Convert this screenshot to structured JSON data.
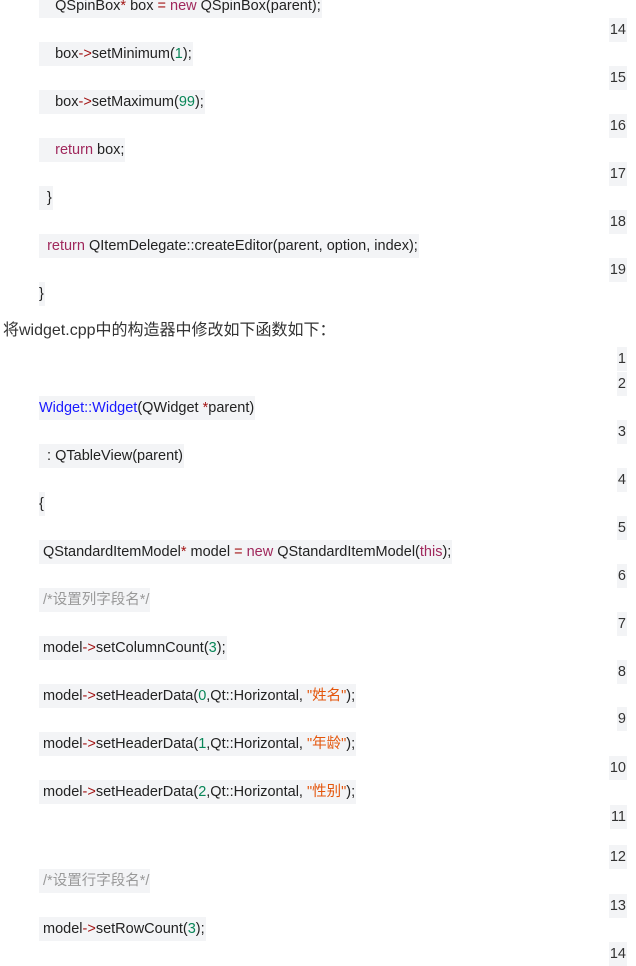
{
  "block1": {
    "lines": [
      [
        [
          "    QSpinBox",
          ""
        ],
        [
          "*",
          "op"
        ],
        [
          " box ",
          ""
        ],
        [
          "=",
          "op"
        ],
        [
          " ",
          ""
        ],
        [
          "new",
          "kw"
        ],
        [
          " QSpinBox(parent);",
          ""
        ]
      ],
      [
        [
          "    box",
          ""
        ],
        [
          "->",
          "op"
        ],
        [
          "setMinimum(",
          ""
        ],
        [
          "1",
          "num"
        ],
        [
          ");",
          ""
        ]
      ],
      [
        [
          "    box",
          ""
        ],
        [
          "->",
          "op"
        ],
        [
          "setMaximum(",
          ""
        ],
        [
          "99",
          "num"
        ],
        [
          ");",
          ""
        ]
      ],
      [
        [
          "    ",
          ""
        ],
        [
          "return",
          "kw"
        ],
        [
          " box;",
          ""
        ]
      ],
      [
        [
          "  }",
          ""
        ]
      ],
      [
        [
          "  ",
          ""
        ],
        [
          "return",
          "kw"
        ],
        [
          " QItemDelegate::createEditor(parent, option, index);",
          ""
        ]
      ],
      [
        [
          "}",
          ""
        ]
      ]
    ],
    "line_numbers": [
      "14",
      "15",
      "16",
      "17",
      "18",
      "19"
    ]
  },
  "heading": "将widget.cpp中的构造器中修改如下函数如下：",
  "block2": {
    "lines": [
      [
        [
          "Widget::Widget",
          "fn"
        ],
        [
          "(QWidget ",
          ""
        ],
        [
          "*",
          "op"
        ],
        [
          "parent)",
          ""
        ]
      ],
      [
        [
          "  : QTableView(parent)",
          ""
        ]
      ],
      [
        [
          "{",
          ""
        ]
      ],
      [
        [
          " QStandardItemModel",
          ""
        ],
        [
          "*",
          "op"
        ],
        [
          " model ",
          ""
        ],
        [
          "=",
          "op"
        ],
        [
          " ",
          ""
        ],
        [
          "new",
          "kw"
        ],
        [
          " QStandardItemModel(",
          ""
        ],
        [
          "this",
          "kw"
        ],
        [
          ");",
          ""
        ]
      ],
      [
        [
          " ",
          ""
        ],
        [
          "/*设置列字段名*/",
          "cm"
        ]
      ],
      [
        [
          " model",
          ""
        ],
        [
          "->",
          "op"
        ],
        [
          "setColumnCount(",
          ""
        ],
        [
          "3",
          "num"
        ],
        [
          ");",
          ""
        ]
      ],
      [
        [
          " model",
          ""
        ],
        [
          "->",
          "op"
        ],
        [
          "setHeaderData(",
          ""
        ],
        [
          "0",
          "num"
        ],
        [
          ",Qt::Horizontal, ",
          ""
        ],
        [
          "\"姓名\"",
          "str"
        ],
        [
          ");",
          ""
        ]
      ],
      [
        [
          " model",
          ""
        ],
        [
          "->",
          "op"
        ],
        [
          "setHeaderData(",
          ""
        ],
        [
          "1",
          "num"
        ],
        [
          ",Qt::Horizontal, ",
          ""
        ],
        [
          "\"年龄\"",
          "str"
        ],
        [
          ");",
          ""
        ]
      ],
      [
        [
          " model",
          ""
        ],
        [
          "->",
          "op"
        ],
        [
          "setHeaderData(",
          ""
        ],
        [
          "2",
          "num"
        ],
        [
          ",Qt::Horizontal, ",
          ""
        ],
        [
          "\"性别\"",
          "str"
        ],
        [
          ");",
          ""
        ]
      ],
      [
        [
          " ",
          ""
        ],
        [
          "/*设置行字段名*/",
          "cm"
        ]
      ],
      [
        [
          " model",
          ""
        ],
        [
          "->",
          "op"
        ],
        [
          "setRowCount(",
          ""
        ],
        [
          "3",
          "num"
        ],
        [
          ");",
          ""
        ]
      ]
    ],
    "line_numbers": [
      "1",
      "2",
      "3",
      "4",
      "5",
      "6",
      "7",
      "8",
      "9",
      "10",
      "11",
      "12",
      "13",
      "14"
    ]
  }
}
